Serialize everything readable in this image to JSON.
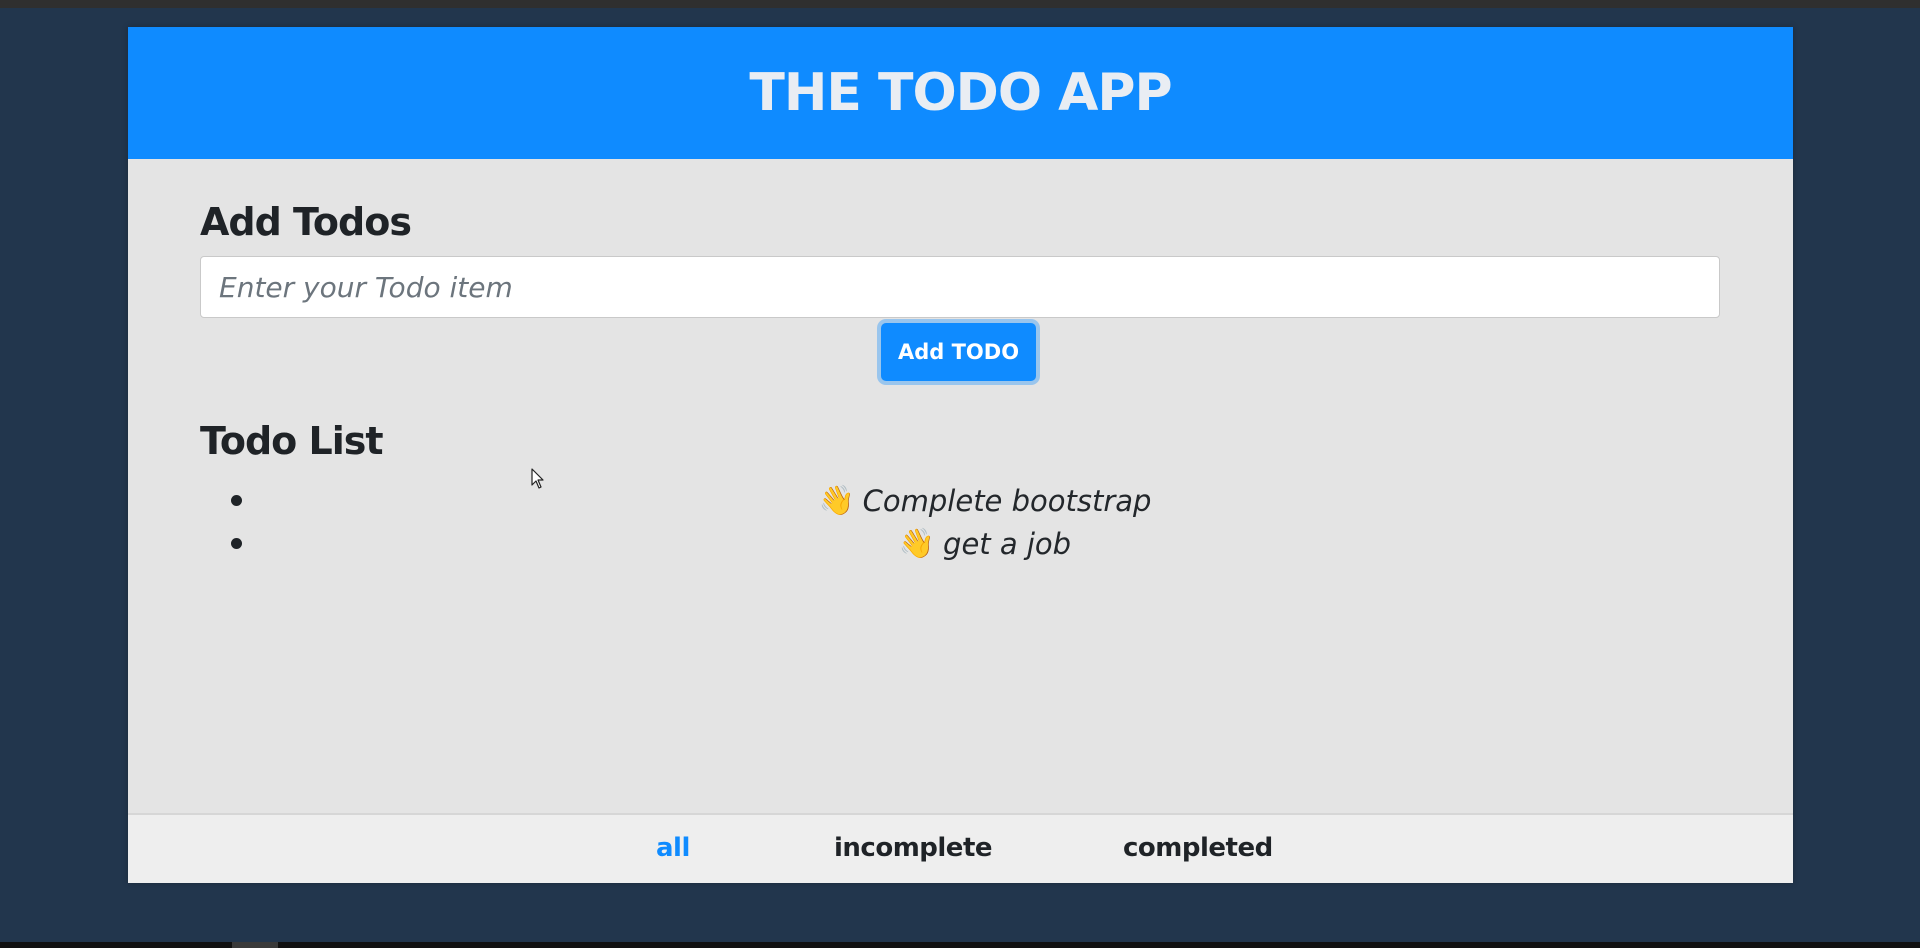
{
  "header": {
    "title": "THE TODO APP"
  },
  "add_section": {
    "heading": "Add Todos",
    "input_placeholder": "Enter your Todo item",
    "input_value": "",
    "button_label": "Add TODO"
  },
  "list_section": {
    "heading": "Todo List",
    "items": [
      {
        "emoji": "👋",
        "text": "Complete bootstrap"
      },
      {
        "emoji": "👋",
        "text": "get a job"
      }
    ]
  },
  "footer": {
    "filters": [
      {
        "label": "all",
        "active": true
      },
      {
        "label": "incomplete",
        "active": false
      },
      {
        "label": "completed",
        "active": false
      }
    ]
  },
  "colors": {
    "accent": "#0f8bff",
    "background": "#22364d",
    "panel": "#e4e4e4",
    "footer": "#eeeeee"
  }
}
